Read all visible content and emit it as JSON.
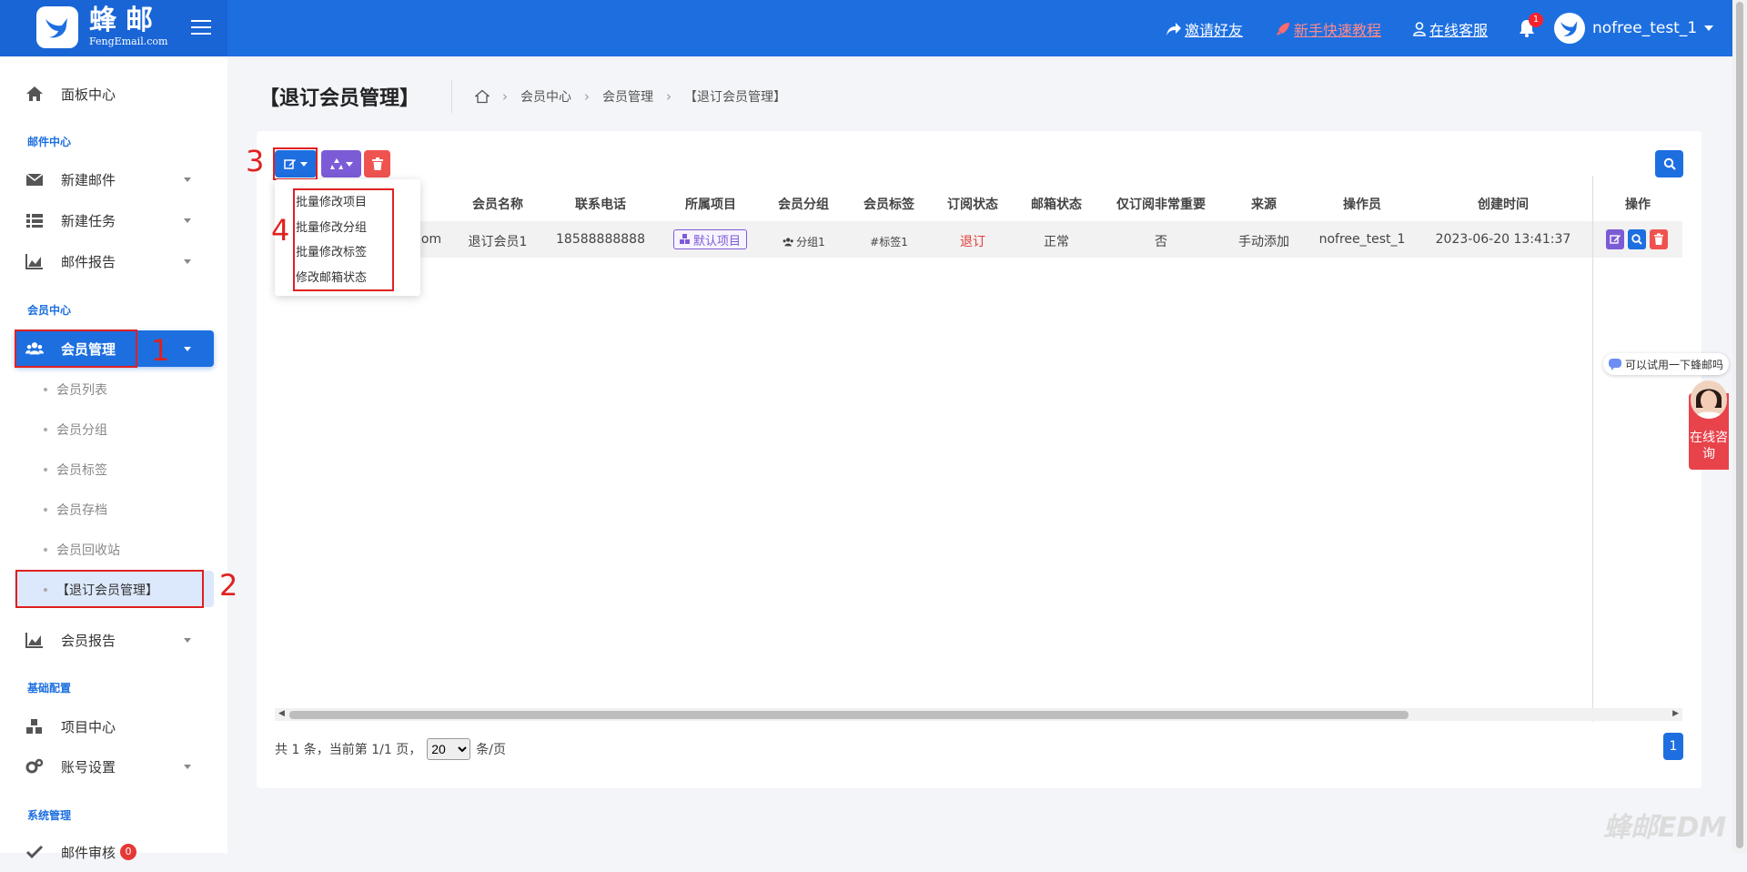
{
  "brand": {
    "name": "蜂邮",
    "sub": "FengEmail.com"
  },
  "topnav": {
    "invite": "邀请好友",
    "tutorial": "新手快速教程",
    "support": "在线客服",
    "bell_count": "1",
    "username": "nofree_test_1"
  },
  "sidebar": {
    "dashboard": "面板中心",
    "section_mail": "邮件中心",
    "new_mail": "新建邮件",
    "new_task": "新建任务",
    "mail_report": "邮件报告",
    "section_member": "会员中心",
    "member_manage": "会员管理",
    "sub": [
      "会员列表",
      "会员分组",
      "会员标签",
      "会员存档",
      "会员回收站",
      "【退订会员管理】"
    ],
    "member_report": "会员报告",
    "section_base": "基础配置",
    "project_center": "项目中心",
    "account_settings": "账号设置",
    "section_system": "系统管理",
    "mail_audit": "邮件审核",
    "mail_audit_badge": "0"
  },
  "annotations": [
    "1",
    "2",
    "3",
    "4"
  ],
  "page": {
    "title": "【退订会员管理】",
    "breadcrumb": [
      "会员中心",
      "会员管理",
      "【退订会员管理】"
    ]
  },
  "dropdown": [
    "批量修改项目",
    "批量修改分组",
    "批量修改标签",
    "修改邮箱状态"
  ],
  "table": {
    "columns": [
      "会员名称",
      "联系电话",
      "所属项目",
      "会员分组",
      "会员标签",
      "订阅状态",
      "邮箱状态",
      "仅订阅非常重要",
      "来源",
      "操作员",
      "创建时间",
      "操作"
    ],
    "row": {
      "email_tail": "om",
      "name": "退订会员1",
      "phone": "18588888888",
      "project": "默认项目",
      "group": "分组1",
      "tag": "#标签1",
      "subscribe": "退订",
      "email_status": "正常",
      "important_only": "否",
      "source": "手动添加",
      "operator": "nofree_test_1",
      "created": "2023-06-20 13:41:37"
    }
  },
  "pager": {
    "summary": "共 1 条，当前第 1/1 页，",
    "page_size": "20",
    "per_page": "条/页",
    "current": "1"
  },
  "chat": {
    "bubble": "可以试用一下蜂邮吗",
    "consult": "在线咨询"
  },
  "watermark": "蜂邮EDM",
  "colors": {
    "primary": "#1d6fe0",
    "purple": "#7c5cd6",
    "danger": "#ef5350",
    "annotation": "#e02020"
  }
}
